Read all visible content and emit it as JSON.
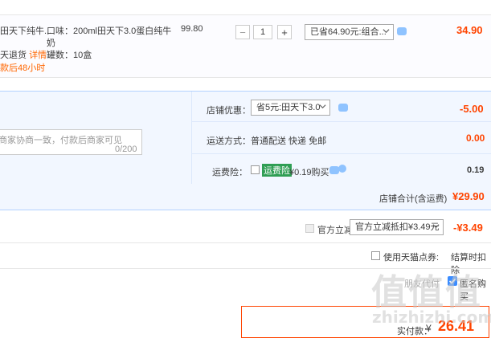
{
  "item": {
    "title": "田天下纯牛...",
    "shipping": "天退货",
    "details_link": "详情",
    "ship_time": "款后48小时",
    "spec_flavor": "口味：200ml田天下3.0蛋白纯牛",
    "spec_flavor_cont": "奶",
    "spec_count": "罐数：10盒",
    "unit_price": "99.80",
    "qty_minus": "−",
    "qty": "1",
    "qty_plus": "+",
    "promo_select": "已省64.90元:组合...",
    "subtotal": "34.90"
  },
  "shop": {
    "discount_label": "店铺优惠：",
    "discount_select": "省5元:田天下3.0",
    "discount_value": "-5.00",
    "message_placeholder": "商家协商一致，付款后商家可见",
    "message_counter": "0/200",
    "delivery_label": "运送方式：",
    "delivery_value": "普通配送 快递 免邮",
    "delivery_price": "0.00",
    "insurance_label": "运费险：",
    "insurance_badge": "运费险",
    "insurance_text": "¥0.19购买",
    "insurance_price": "0.19",
    "total_label": "店铺合计(含运费)",
    "total_value": "¥29.90"
  },
  "official": {
    "label": "官方立减",
    "select": "官方立减抵扣¥3.49元",
    "value": "-¥3.49"
  },
  "coupon": {
    "label": "使用天猫点券:",
    "status": "结算时扣除"
  },
  "anon": {
    "label": "匿名购买",
    "partial": "朋友代付"
  },
  "payment": {
    "label": "实付款：",
    "currency": "¥",
    "amount": "26.41"
  },
  "watermark": {
    "logo": "值值值",
    "site": "zhizhizhi.com"
  }
}
